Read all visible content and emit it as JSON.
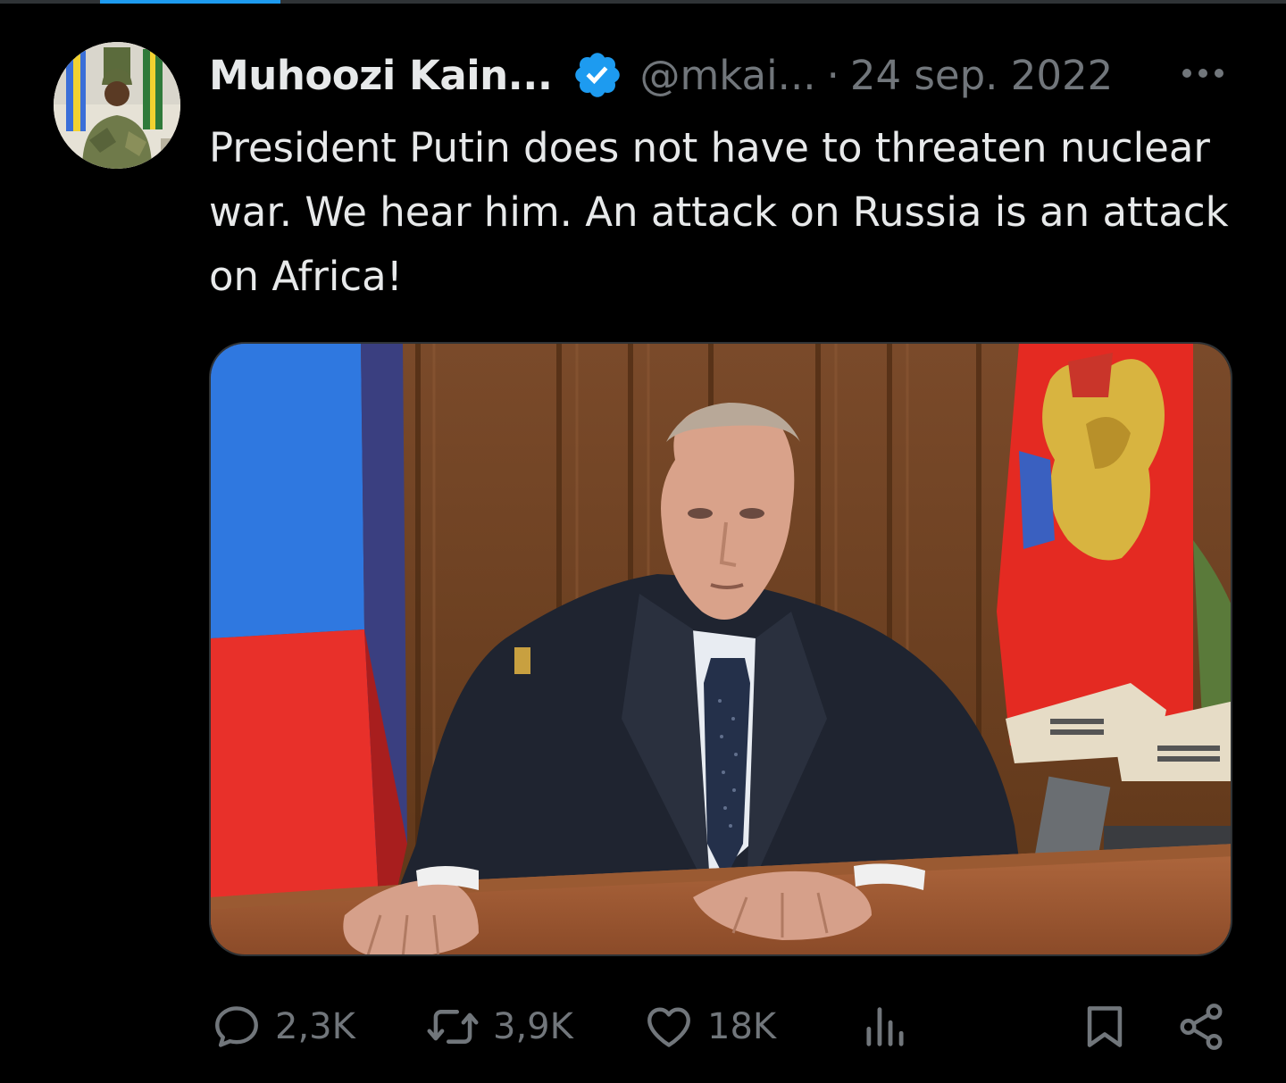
{
  "tweet": {
    "author_name": "Muhoozi Kain...",
    "handle": "@mkai...",
    "separator": "·",
    "date": "24 sep. 2022",
    "text": "President Putin does not have to threaten nuclear war. We hear him. An attack on Russia is an attack on Africa!",
    "verified": true
  },
  "metrics": {
    "replies": "2,3K",
    "reposts": "3,9K",
    "likes": "18K"
  },
  "colors": {
    "background": "#000000",
    "text_primary": "#e7e9ea",
    "text_secondary": "#71767b",
    "verified_badge": "#1d9bf0",
    "divider": "#2f3336"
  },
  "icons": {
    "verified": "verified-badge-icon",
    "more": "more-options-icon",
    "reply": "reply-icon",
    "repost": "repost-icon",
    "like": "like-icon",
    "views": "views-icon",
    "bookmark": "bookmark-icon",
    "share": "share-icon"
  }
}
